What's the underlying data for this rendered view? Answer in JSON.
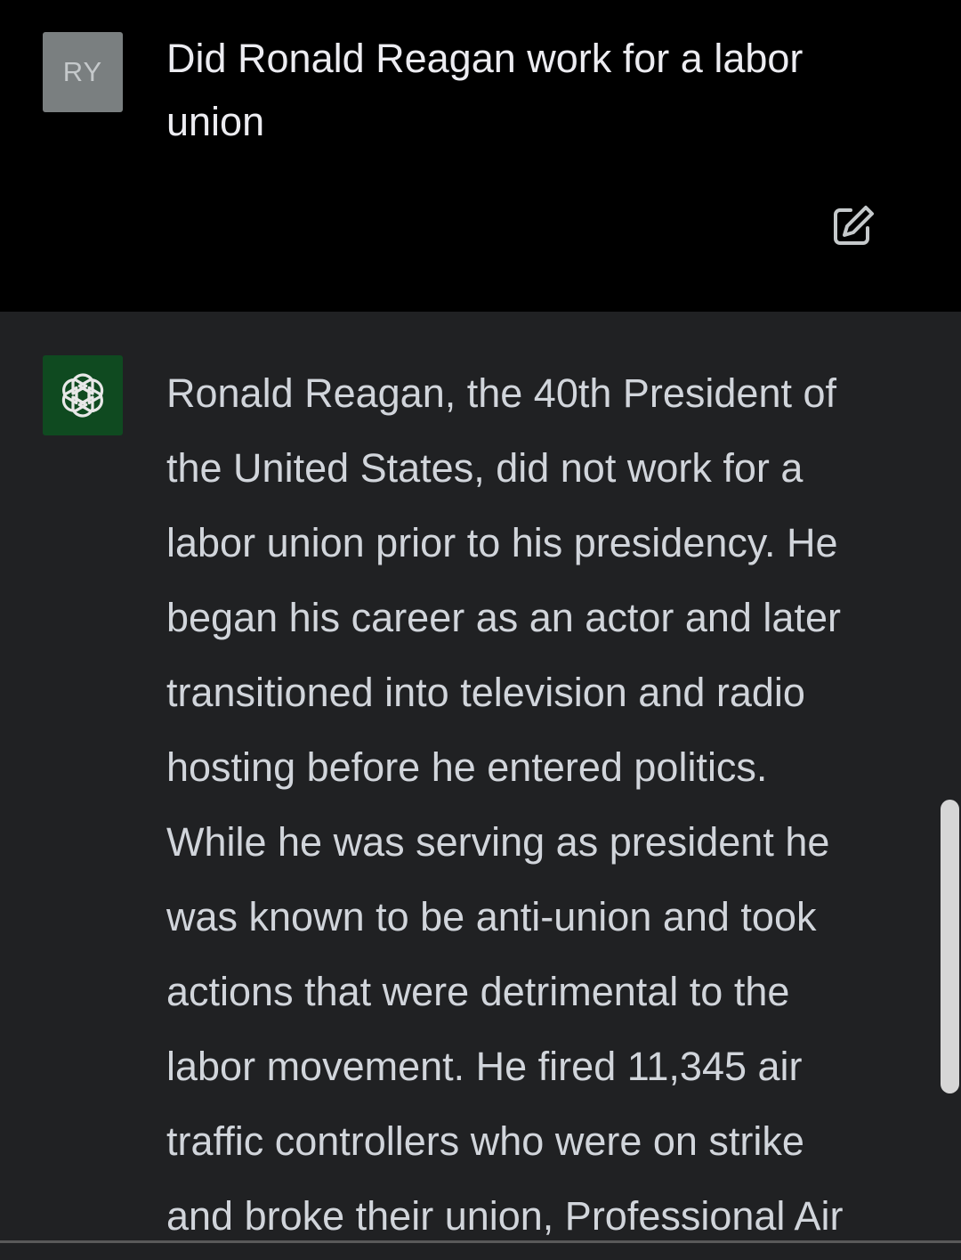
{
  "user_message": {
    "avatar_initials": "RY",
    "text": "Did Ronald Reagan work for a labor union",
    "edit_icon": "edit-icon"
  },
  "assistant_message": {
    "avatar_icon": "openai-logo-icon",
    "lines": [
      "Ronald Reagan, the 40th President of",
      "the United States, did not work for a",
      "labor union prior to his presidency. He",
      "began his career as an actor and later",
      "transitioned into television and radio",
      "hosting before he entered politics.",
      "While he was serving as president he",
      "was known to be anti-union and took",
      "actions that were detrimental to the",
      "labor movement. He fired 11,345 air",
      "traffic controllers who were on strike",
      "and broke their union, Professional Air"
    ]
  },
  "colors": {
    "page_background": "#000000",
    "assistant_background": "#202123",
    "user_avatar": "#7a7f80",
    "assistant_avatar": "#0f4a20",
    "text": "#d1d5db",
    "scrollbar_thumb": "#d6d6d6"
  }
}
